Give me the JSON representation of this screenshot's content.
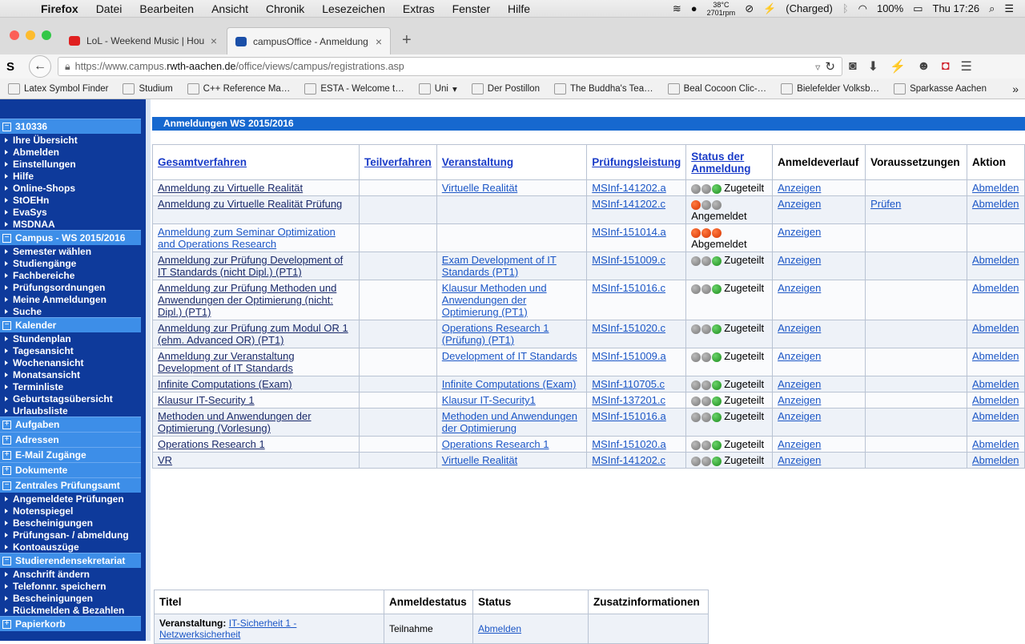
{
  "menubar": {
    "app": "Firefox",
    "items": [
      "Datei",
      "Bearbeiten",
      "Ansicht",
      "Chronik",
      "Lesezeichen",
      "Extras",
      "Fenster",
      "Hilfe"
    ],
    "temp": "38°C",
    "rpm": "2701rpm",
    "charge": "(Charged)",
    "battery": "100%",
    "clock": "Thu 17:26"
  },
  "tabs": [
    {
      "title": "LoL - Weekend Music | Hou…",
      "color": "#e02020"
    },
    {
      "title": "campusOffice - Anmeldung…",
      "color": "#1a4fa8"
    }
  ],
  "url": {
    "prefix": "https://www.campus.",
    "host": "rwth-aachen.de",
    "path": "/office/views/campus/registrations.asp"
  },
  "bookmarks": [
    "Latex Symbol Finder",
    "Studium",
    "C++ Reference Ma…",
    "ESTA - Welcome t…",
    "Uni",
    "Der Postillon",
    "The Buddha's Tea…",
    "Beal Cocoon Clic-…",
    "Bielefelder Volksb…",
    "Sparkasse Aachen"
  ],
  "sidebar": [
    {
      "head": "310336",
      "items": [
        "Ihre Übersicht",
        "Abmelden",
        "Einstellungen",
        "Hilfe",
        "Online-Shops",
        "StOEHn",
        "EvaSys",
        "MSDNAA"
      ]
    },
    {
      "head": "Campus - WS 2015/2016",
      "items": [
        "Semester wählen",
        "Studiengänge",
        "Fachbereiche",
        "Prüfungsordnungen",
        "Meine Anmeldungen",
        "Suche"
      ]
    },
    {
      "head": "Kalender",
      "items": [
        "Stundenplan",
        "Tagesansicht",
        "Wochenansicht",
        "Monatsansicht",
        "Terminliste",
        "Geburtstagsübersicht",
        "Urlaubsliste"
      ]
    },
    {
      "head": "Aufgaben",
      "items": []
    },
    {
      "head": "Adressen",
      "items": []
    },
    {
      "head": "E-Mail Zugänge",
      "items": []
    },
    {
      "head": "Dokumente",
      "items": []
    },
    {
      "head": "Zentrales Prüfungsamt",
      "items": [
        "Angemeldete Prüfungen",
        "Notenspiegel",
        "Bescheinigungen",
        "Prüfungsan- / abmeldung",
        "Kontoauszüge"
      ]
    },
    {
      "head": "Studierendensekretariat",
      "items": [
        "Anschrift ändern",
        "Telefonnr. speichern",
        "Bescheinigungen",
        "Rückmelden & Bezahlen"
      ]
    },
    {
      "head": "Papierkorb",
      "items": []
    }
  ],
  "section_title": "Anmeldungen WS 2015/2016",
  "columns": [
    "Gesamtverfahren",
    "Teilverfahren",
    "Veranstaltung",
    "Prüfungsleistung",
    "Status der Anmeldung",
    "Anmeldeverlauf",
    "Voraussetzungen",
    "Aktion"
  ],
  "rows": [
    {
      "gv": "Anmeldung zu Virtuelle Realität",
      "tv": "",
      "va": "Virtuelle Realität",
      "pl": "MSInf-141202.a",
      "dots": [
        "n",
        "n",
        "g"
      ],
      "status": "Zugeteilt",
      "verlauf": "Anzeigen",
      "vor": "",
      "aktion": "Abmelden"
    },
    {
      "gv": "Anmeldung zu Virtuelle Realität Prüfung",
      "tv": "",
      "va": "",
      "pl": "MSInf-141202.c",
      "dots": [
        "r",
        "n",
        "n"
      ],
      "status": "Angemeldet",
      "verlauf": "Anzeigen",
      "vor": "Prüfen",
      "aktion": "Abmelden"
    },
    {
      "gv": "Anmeldung zum Seminar Optimization and Operations Research",
      "tv": "",
      "va": "",
      "pl": "MSInf-151014.a",
      "dots": [
        "r",
        "r",
        "r"
      ],
      "status": "Abgemeldet",
      "verlauf": "Anzeigen",
      "vor": "",
      "aktion": ""
    },
    {
      "gv": "Anmeldung zur Prüfung Development of IT Standards (nicht Dipl.) (PT1)",
      "tv": "",
      "va": "Exam Development of IT Standards (PT1)",
      "pl": "MSInf-151009.c",
      "dots": [
        "n",
        "n",
        "g"
      ],
      "status": "Zugeteilt",
      "verlauf": "Anzeigen",
      "vor": "",
      "aktion": "Abmelden"
    },
    {
      "gv": "Anmeldung zur Prüfung Methoden und Anwendungen der Optimierung (nicht: Dipl.) (PT1)",
      "tv": "",
      "va": "Klausur Methoden und Anwendungen der Optimierung (PT1)",
      "pl": "MSInf-151016.c",
      "dots": [
        "n",
        "n",
        "g"
      ],
      "status": "Zugeteilt",
      "verlauf": "Anzeigen",
      "vor": "",
      "aktion": "Abmelden"
    },
    {
      "gv": "Anmeldung zur Prüfung zum Modul OR 1 (ehm. Advanced OR) (PT1)",
      "tv": "",
      "va": "Operations Research 1 (Prüfung) (PT1)",
      "pl": "MSInf-151020.c",
      "dots": [
        "n",
        "n",
        "g"
      ],
      "status": "Zugeteilt",
      "verlauf": "Anzeigen",
      "vor": "",
      "aktion": "Abmelden"
    },
    {
      "gv": "Anmeldung zur Veranstaltung Development of IT Standards",
      "tv": "",
      "va": "Development of IT Standards",
      "pl": "MSInf-151009.a",
      "dots": [
        "n",
        "n",
        "g"
      ],
      "status": "Zugeteilt",
      "verlauf": "Anzeigen",
      "vor": "",
      "aktion": "Abmelden"
    },
    {
      "gv": "Infinite Computations (Exam)",
      "tv": "",
      "va": "Infinite Computations (Exam)",
      "pl": "MSInf-110705.c",
      "dots": [
        "n",
        "n",
        "g"
      ],
      "status": "Zugeteilt",
      "verlauf": "Anzeigen",
      "vor": "",
      "aktion": "Abmelden"
    },
    {
      "gv": "Klausur IT-Security 1",
      "tv": "",
      "va": "Klausur IT-Security1",
      "pl": "MSInf-137201.c",
      "dots": [
        "n",
        "n",
        "g"
      ],
      "status": "Zugeteilt",
      "verlauf": "Anzeigen",
      "vor": "",
      "aktion": "Abmelden"
    },
    {
      "gv": "Methoden und Anwendungen der Optimierung (Vorlesung)",
      "tv": "",
      "va": "Methoden und Anwendungen der Optimierung",
      "pl": "MSInf-151016.a",
      "dots": [
        "n",
        "n",
        "g"
      ],
      "status": "Zugeteilt",
      "verlauf": "Anzeigen",
      "vor": "",
      "aktion": "Abmelden"
    },
    {
      "gv": "Operations Research 1",
      "tv": "",
      "va": "Operations Research 1",
      "pl": "MSInf-151020.a",
      "dots": [
        "n",
        "n",
        "g"
      ],
      "status": "Zugeteilt",
      "verlauf": "Anzeigen",
      "vor": "",
      "aktion": "Abmelden"
    },
    {
      "gv": "VR",
      "tv": "",
      "va": "Virtuelle Realität",
      "pl": "MSInf-141202.c",
      "dots": [
        "n",
        "n",
        "g"
      ],
      "status": "Zugeteilt",
      "verlauf": "Anzeigen",
      "vor": "",
      "aktion": "Abmelden"
    }
  ],
  "sub": {
    "columns": [
      "Titel",
      "Anmeldestatus",
      "Status",
      "Zusatzinformationen"
    ],
    "row": {
      "label": "Veranstaltung:",
      "link": "IT-Sicherheit 1 - Netzwerksicherheit",
      "anmeldestatus": "Teilnahme",
      "status": "Abmelden",
      "zusatz": ""
    }
  }
}
